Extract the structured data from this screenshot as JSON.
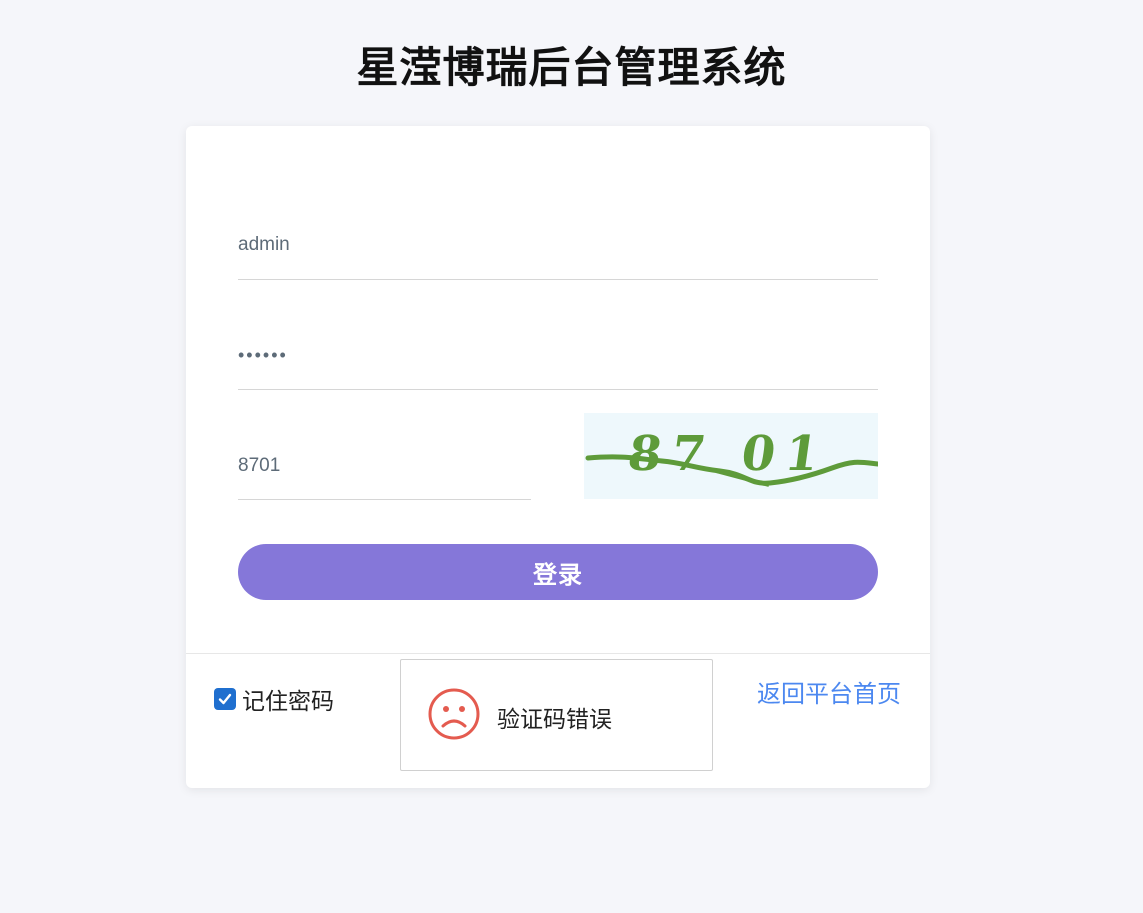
{
  "header": {
    "title": "星滢博瑞后台管理系统"
  },
  "form": {
    "username_value": "admin",
    "password_value": "••••••",
    "captcha_value": "8701",
    "captcha_image_text": "87 01",
    "login_label": "登录"
  },
  "footer": {
    "remember_label": "记住密码",
    "remember_checked": true,
    "back_link_label": "返回平台首页"
  },
  "toast": {
    "icon": "sad-face-icon",
    "message": "验证码错误"
  },
  "colors": {
    "accent": "#8577d9",
    "link": "#4c88f0",
    "checkbox": "#1f6fcf",
    "error_icon": "#e45b4f",
    "captcha_green": "#5e9b3a",
    "background": "#f5f6fa"
  }
}
